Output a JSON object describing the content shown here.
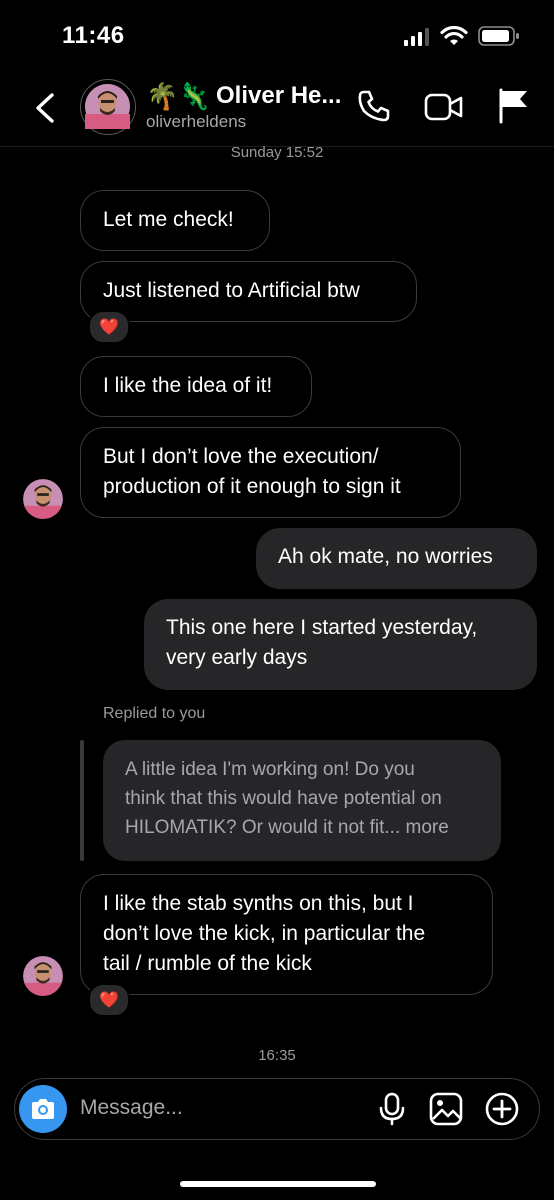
{
  "status_bar": {
    "time": "11:46"
  },
  "header": {
    "name": "Oliver He...",
    "username": "oliverheldens",
    "emoji": "🌴🦎",
    "back_icon": "chevron-left-icon",
    "call_icon": "phone-icon",
    "video_icon": "video-camera-icon",
    "flag_icon": "flag-icon"
  },
  "timestamps": {
    "first": "Sunday 15:52",
    "second": "16:35"
  },
  "messages": [
    {
      "text": "Let me check!"
    },
    {
      "text": "Just listened to Artificial btw",
      "reaction": "❤️"
    },
    {
      "text": "I like the idea of it!"
    },
    {
      "lines": [
        "But I don’t love the execution/",
        "production of it enough to sign it"
      ]
    },
    {
      "text": "Ah ok mate, no worries"
    },
    {
      "lines": [
        "This one here I started yesterday,",
        "very early days"
      ]
    },
    {
      "lines": [
        "I like the stab synths on this, but I",
        "don’t love the kick, in particular the",
        "tail / rumble of the kick"
      ],
      "reaction": "❤️"
    }
  ],
  "reply": {
    "label": "Replied to you",
    "quote_lines": [
      "A little idea I'm working on! Do you",
      "think that this would have potential on",
      "HILOMATIK? Or would it not fit... more"
    ]
  },
  "composer": {
    "placeholder": "Message...",
    "camera_icon": "camera-icon",
    "mic_icon": "microphone-icon",
    "gallery_icon": "image-icon",
    "add_icon": "plus-circle-icon",
    "accent": "#3797f0"
  }
}
